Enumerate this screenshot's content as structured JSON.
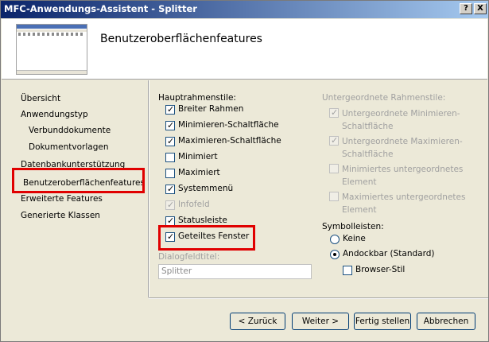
{
  "window": {
    "title": "MFC-Anwendungs-Assistent - Splitter",
    "help_btn": "?",
    "close_btn": "X"
  },
  "header": {
    "title": "Benutzeroberflächenfeatures"
  },
  "nav": {
    "items": [
      {
        "label": "Übersicht"
      },
      {
        "label": "Anwendungstyp"
      },
      {
        "label": "Verbunddokumente"
      },
      {
        "label": "Dokumentvorlagen"
      },
      {
        "label": "Datenbankunterstützung"
      },
      {
        "label": "Benutzeroberflächenfeatures"
      },
      {
        "label": "Erweiterte Features"
      },
      {
        "label": "Generierte Klassen"
      }
    ]
  },
  "main": {
    "frame_styles_label": "Hauptrahmenstile:",
    "frame_styles": [
      {
        "label": "Breiter Rahmen",
        "checked": true
      },
      {
        "label": "Minimieren-Schaltfläche",
        "checked": true
      },
      {
        "label": "Maximieren-Schaltfläche",
        "checked": true
      },
      {
        "label": "Minimiert",
        "checked": false
      },
      {
        "label": "Maximiert",
        "checked": false
      },
      {
        "label": "Systemmenü",
        "checked": true
      },
      {
        "label": "Infofeld",
        "checked": true,
        "disabled": true
      },
      {
        "label": "Statusleiste",
        "checked": true
      },
      {
        "label": "Geteiltes Fenster",
        "checked": true
      }
    ],
    "dialog_title_label": "Dialogfeldtitel:",
    "dialog_title_value": "Splitter",
    "child_styles_label": "Untergeordnete Rahmenstile:",
    "child_styles": [
      {
        "line1": "Untergeordnete Minimieren-",
        "line2": "Schaltfläche",
        "checked": true
      },
      {
        "line1": "Untergeordnete Maximieren-",
        "line2": "Schaltfläche",
        "checked": true
      },
      {
        "line1": "Minimiertes untergeordnetes",
        "line2": "Element",
        "checked": false
      },
      {
        "line1": "Maximiertes untergeordnetes",
        "line2": "Element",
        "checked": false
      }
    ],
    "toolbars_label": "Symbolleisten:",
    "toolbars": [
      {
        "label": "Keine",
        "selected": false
      },
      {
        "label": "Andockbar (Standard)",
        "selected": true
      }
    ],
    "browser_style": {
      "label": "Browser-Stil",
      "checked": false
    }
  },
  "buttons": {
    "back": "< Zurück",
    "next": "Weiter >",
    "finish": "Fertig stellen",
    "cancel": "Abbrechen"
  },
  "colors": {
    "highlight_box": "#E00000",
    "titlebar_start": "#0A246A",
    "titlebar_end": "#A6CAF0"
  }
}
